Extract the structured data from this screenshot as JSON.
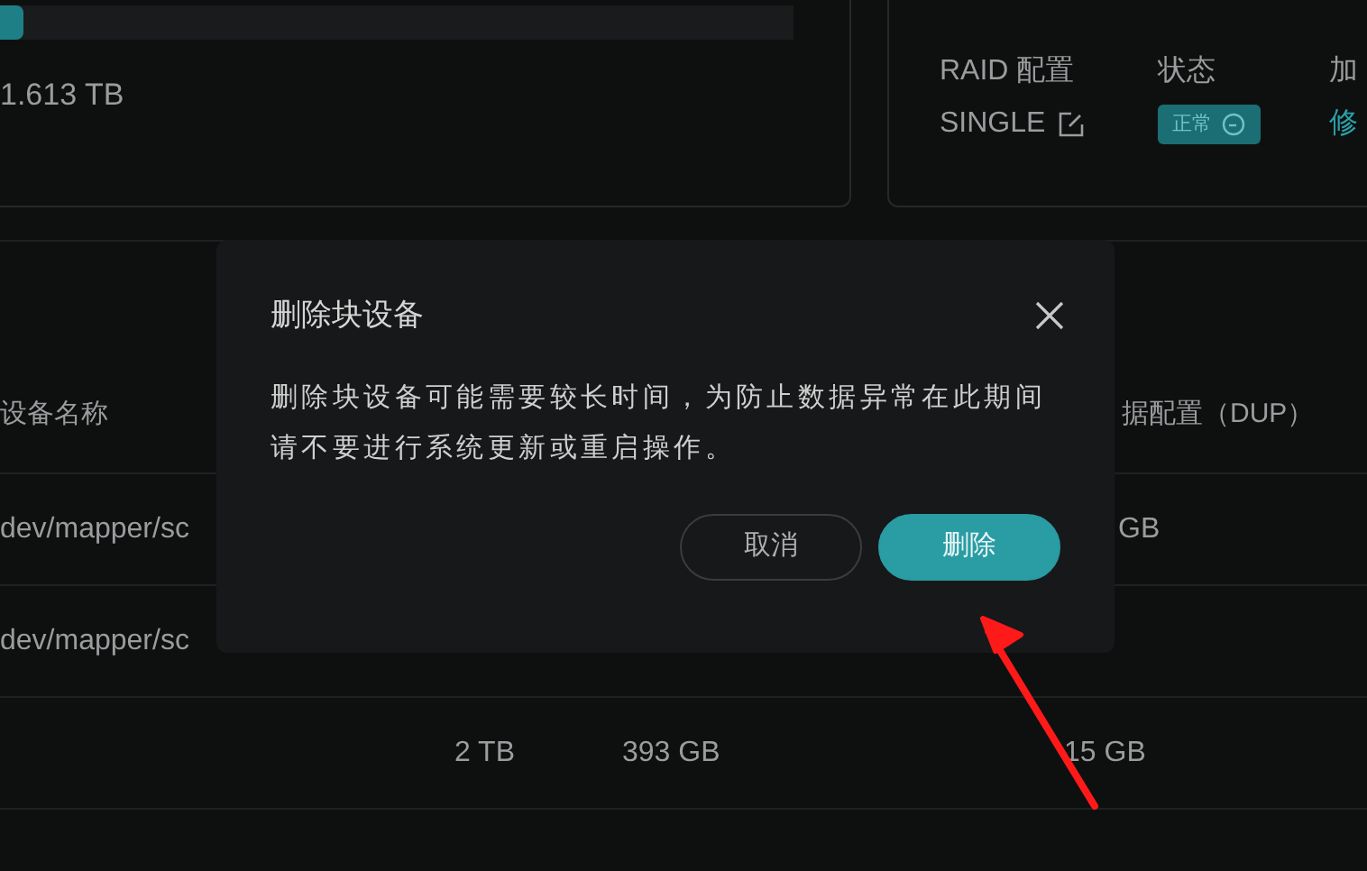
{
  "usage": {
    "level": 0.03,
    "used": "1.613 TB"
  },
  "volume": {
    "fields": [
      {
        "label": "RAID 配置",
        "value": "SINGLE",
        "kind": "editable"
      },
      {
        "label": "状态",
        "value": "正常",
        "kind": "badge"
      },
      {
        "label": "加",
        "value": "修",
        "kind": "link"
      }
    ]
  },
  "table": {
    "column_1": "设备名称",
    "column_4": "据配置（DUP）",
    "rows": [
      {
        "device": "dev/mapper/sc",
        "column_4": "GB"
      },
      {
        "device": "dev/mapper/sc"
      },
      {
        "column_2": "2 TB",
        "column_3": "393 GB",
        "column_4": "15 GB"
      }
    ]
  },
  "dialog": {
    "title": "删除块设备",
    "message": "删除块设备可能需要较长时间，为防止数据异常在此期间请不要进行系统更新或重启操作。",
    "buttons": [
      {
        "label": "取消",
        "kind": "secondary"
      },
      {
        "label": "删除",
        "kind": "primary"
      }
    ]
  }
}
